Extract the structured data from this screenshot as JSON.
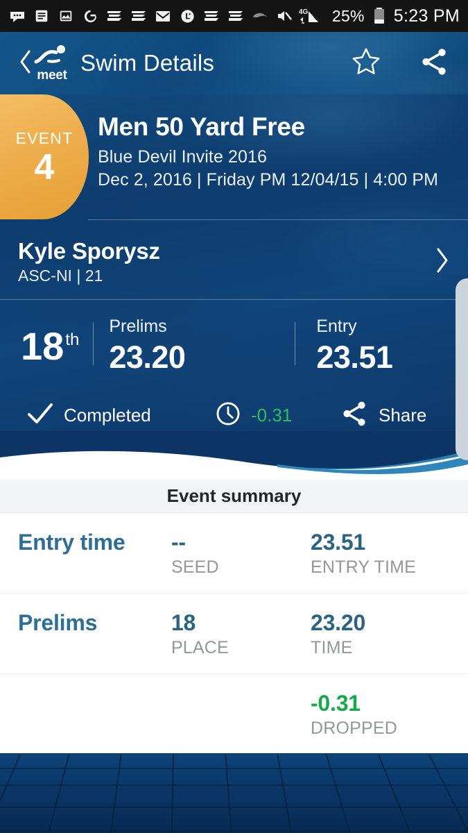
{
  "statusbar": {
    "icons_left": [
      "messages-icon",
      "news-icon",
      "photos-icon",
      "google-icon",
      "espn-icon-1",
      "espn-icon-2",
      "gmail-icon",
      "life360-icon",
      "espn-icon-3",
      "espn-icon-4",
      "ravens-icon"
    ],
    "mute_icon": "mute-icon",
    "network": "4G",
    "battery_percent": "25%",
    "time": "5:23 PM"
  },
  "appbar": {
    "back_icon": "back-chevron-icon",
    "brand": "meet",
    "brand_icon": "swimmer-logo-icon",
    "title": "Swim Details",
    "favorite_icon": "star-icon",
    "share_icon": "share-icon"
  },
  "event": {
    "tab_label": "EVENT",
    "tab_number": "4",
    "title": "Men 50 Yard Free",
    "meet": "Blue Devil Invite 2016",
    "date": "Dec 2, 2016 | Friday PM 12/04/15 | 4:00 PM"
  },
  "swimmer": {
    "name": "Kyle Sporysz",
    "team": "ASC-NI | 21",
    "chevron_icon": "chevron-right-icon"
  },
  "results": {
    "place_number": "18",
    "place_suffix": "th",
    "prelims_label": "Prelims",
    "prelims_value": "23.20",
    "entry_label": "Entry",
    "entry_value": "23.51"
  },
  "actions": {
    "completed_icon": "check-icon",
    "completed_label": "Completed",
    "clock_icon": "clock-icon",
    "drop_value": "-0.31",
    "share_icon": "share-icon",
    "share_label": "Share"
  },
  "summary": {
    "heading": "Event summary",
    "rows": [
      {
        "title": "Entry time",
        "mid_value": "--",
        "mid_caption": "SEED",
        "right_value": "23.51",
        "right_caption": "ENTRY TIME",
        "right_green": false
      },
      {
        "title": "Prelims",
        "mid_value": "18",
        "mid_caption": "PLACE",
        "right_value": "23.20",
        "right_caption": "TIME",
        "right_green": false
      },
      {
        "title": "",
        "mid_value": "",
        "mid_caption": "",
        "right_value": "-0.31",
        "right_caption": "DROPPED",
        "right_green": true
      }
    ]
  },
  "colors": {
    "header_blue": "#14568a",
    "hero_blue": "#0d3c6d",
    "accent_orange": "#eead4c",
    "link_blue": "#2e6d96",
    "value_blue": "#2b6382",
    "green": "#16a94a",
    "caption_grey": "#949799"
  }
}
